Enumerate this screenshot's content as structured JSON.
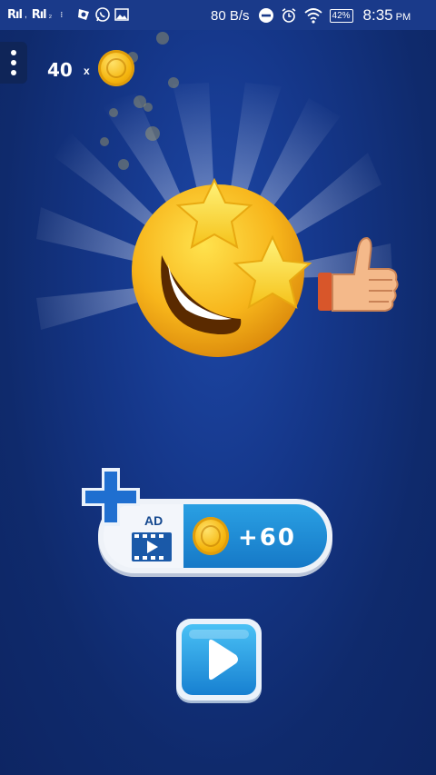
{
  "status_bar": {
    "signal_1": "Rıl",
    "signal_2": "Rıl",
    "network_speed": "80 B/s",
    "battery": "42%",
    "time": "8:35",
    "time_suffix": "PM",
    "icons": [
      "signal-icon",
      "signal-icon",
      "more-icon",
      "app-icon",
      "whatsapp-icon",
      "gallery-icon",
      "do-not-disturb-icon",
      "alarm-icon",
      "wifi-icon",
      "battery-icon"
    ]
  },
  "hud": {
    "coin_count": "40",
    "multiplier": "x",
    "icons": [
      "menu-icon",
      "coin-icon"
    ]
  },
  "hero": {
    "icons": [
      "star-struck-emoji-icon",
      "thumbs-up-icon",
      "star-icon"
    ]
  },
  "ad_offer": {
    "label": "AD",
    "reward": "+60",
    "icons": [
      "plus-icon",
      "video-icon",
      "coin-icon"
    ]
  },
  "play_button": {
    "icon": "play-icon"
  },
  "colors": {
    "background": "#122d6e",
    "status_bar": "#1a3a8a",
    "coin": "#f5b60f",
    "ad_blue": "#1a86d2",
    "plus_blue": "#1f6fd0"
  }
}
